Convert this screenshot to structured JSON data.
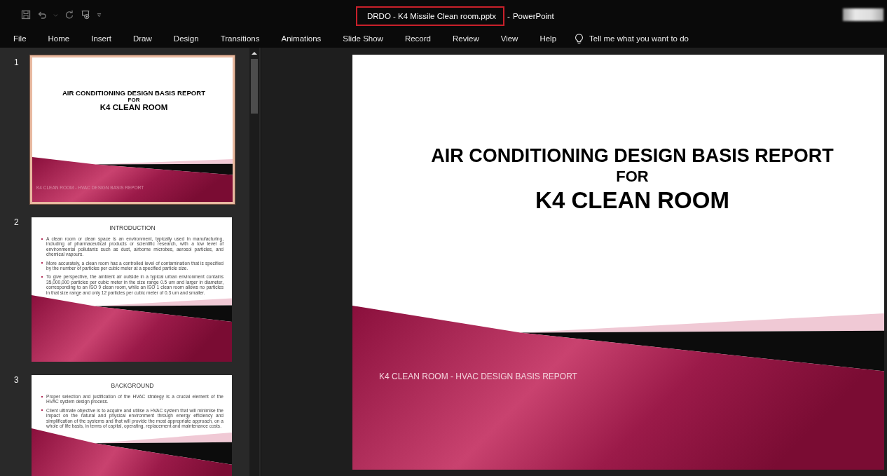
{
  "window": {
    "file_name": "DRDO - K4 Missile Clean room.pptx",
    "highlighted": true,
    "separator": "-",
    "app": "PowerPoint"
  },
  "ribbon_tabs": [
    "File",
    "Home",
    "Insert",
    "Draw",
    "Design",
    "Transitions",
    "Animations",
    "Slide Show",
    "Record",
    "Review",
    "View",
    "Help"
  ],
  "tell_me": "Tell me what you want to do",
  "slides": [
    {
      "number": "1",
      "selected": true,
      "kind": "title",
      "title": "AIR CONDITIONING DESIGN BASIS REPORT",
      "connector": "FOR",
      "subject": "K4 CLEAN ROOM",
      "footer": "K4 CLEAN ROOM - HVAC DESIGN  BASIS REPORT"
    },
    {
      "number": "2",
      "selected": false,
      "kind": "content",
      "heading": "INTRODUCTION",
      "bullets": [
        "A clean room or clean space is an environment, typically used in manufacturing, including of pharmaceutical products or scientific research, with a low level of environmental pollutants such as dust, airborne microbes, aerosol particles, and chemical vapours.",
        "More accurately, a clean room has a controlled level of contamination that is specified by the number of particles per cubic meter at a specified particle size.",
        "To give perspective, the ambient air outside in a typical urban environment contains 35,000,000 particles per cubic meter in the size range 0.5 um and larger in diameter, corresponding to an ISO 9 clean room, while an ISO 1 clean room allows no particles in that size range and only 12 particles per cubic meter of 0.3 um and smaller."
      ]
    },
    {
      "number": "3",
      "selected": false,
      "kind": "content",
      "heading": "BACKGROUND",
      "bullets": [
        "Proper selection and justification of the HVAC strategy is a crucial element of the HVAC system design process.",
        "Client ultimate objective is to acquire and utilise a HVAC system that will minimise the impact on the natural and physical environment through energy efficiency and simplification of the systems and that will provide the most appropriate approach, on a whole of life basis, in terms of capital, operating, replacement and maintenance costs."
      ]
    }
  ],
  "current_slide": {
    "kind": "title",
    "title": "AIR CONDITIONING DESIGN BASIS REPORT",
    "connector": "FOR",
    "subject": "K4 CLEAN ROOM",
    "footer": "K4 CLEAN ROOM - HVAC DESIGN  BASIS REPORT"
  }
}
